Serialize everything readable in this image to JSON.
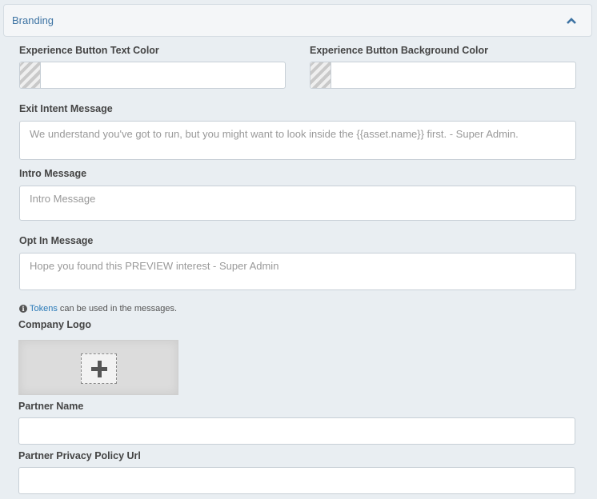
{
  "panel": {
    "title": "Branding",
    "collapse_icon": "chevron-up-icon"
  },
  "fields": {
    "button_text_color": {
      "label": "Experience Button Text Color",
      "value": ""
    },
    "button_bg_color": {
      "label": "Experience Button Background Color",
      "value": ""
    },
    "exit_intent": {
      "label": "Exit Intent Message",
      "placeholder": "We understand you've got to run, but you might want to look inside the {{asset.name}} first. - Super Admin."
    },
    "intro": {
      "label": "Intro Message",
      "placeholder": "Intro Message"
    },
    "opt_in": {
      "label": "Opt In Message",
      "placeholder": "Hope you found this PREVIEW interest - Super Admin"
    },
    "company_logo": {
      "label": "Company Logo",
      "upload_icon": "plus-icon"
    },
    "partner_name": {
      "label": "Partner Name",
      "value": ""
    },
    "partner_privacy_url": {
      "label": "Partner Privacy Policy Url",
      "value": ""
    }
  },
  "help": {
    "icon": "info-icon",
    "link_text": "Tokens",
    "text": "can be used in the messages."
  }
}
